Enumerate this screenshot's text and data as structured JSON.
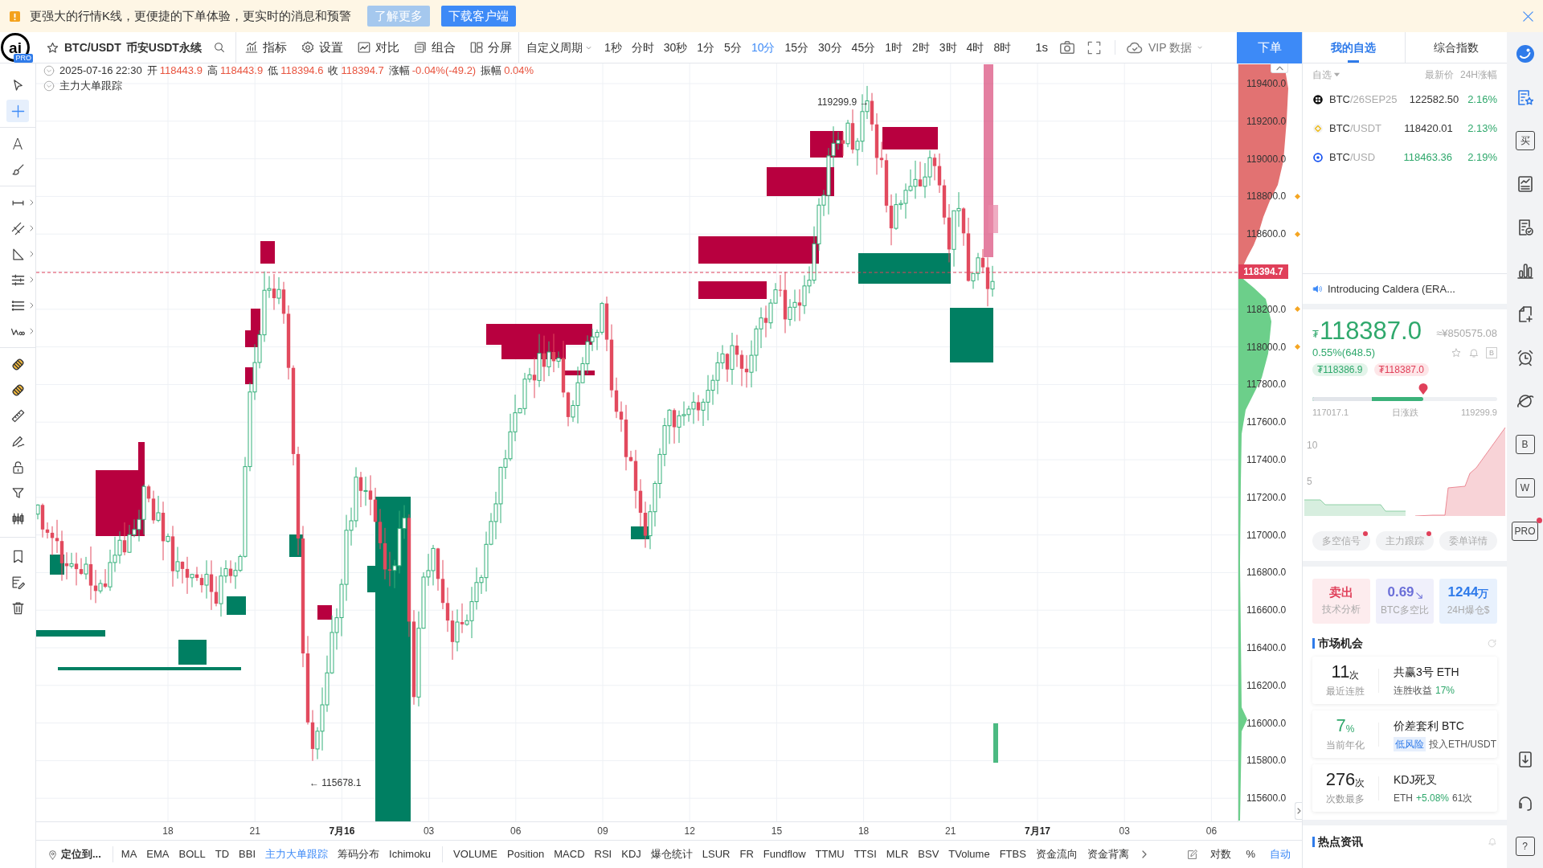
{
  "banner": {
    "message": "更强大的行情K线，更便捷的下单体验，更实时的消息和预警",
    "buttons": [
      {
        "label": "了解更多",
        "kind": "secondary"
      },
      {
        "label": "下载客户端",
        "kind": "primary"
      }
    ]
  },
  "toolbar": {
    "logo": {
      "mark": "ai",
      "badge": "PRO"
    },
    "symbol": "BTC/USDT",
    "market": "币安USDT永续",
    "tools": [
      "指标",
      "设置",
      "对比",
      "组合",
      "分屏"
    ],
    "custom_period": "自定义周期",
    "periods": [
      {
        "label": "1秒",
        "selected": false
      },
      {
        "label": "分时",
        "selected": false
      },
      {
        "label": "30秒",
        "selected": false
      },
      {
        "label": "1分",
        "selected": false
      },
      {
        "label": "5分",
        "selected": false
      },
      {
        "label": "10分",
        "selected": true
      },
      {
        "label": "15分",
        "selected": false
      },
      {
        "label": "30分",
        "selected": false
      },
      {
        "label": "45分",
        "selected": false
      },
      {
        "label": "1时",
        "selected": false
      },
      {
        "label": "2时",
        "selected": false
      },
      {
        "label": "3时",
        "selected": false
      },
      {
        "label": "4时",
        "selected": false
      },
      {
        "label": "8时",
        "selected": false
      }
    ],
    "interval": "1s",
    "vip": "VIP 数据",
    "order_button": "下单"
  },
  "tool_groups": [
    {
      "tools": [
        {
          "selected": false,
          "submenu": false
        },
        {
          "selected": true,
          "submenu": false
        }
      ]
    },
    {
      "tools": [
        {
          "glyph": "A",
          "selected": false,
          "submenu": false
        },
        {
          "selected": false,
          "submenu": false
        }
      ]
    },
    {
      "tools": [
        {
          "selected": false,
          "submenu": true
        },
        {
          "selected": false,
          "submenu": true
        },
        {
          "selected": false,
          "submenu": true
        },
        {
          "selected": false,
          "submenu": true
        },
        {
          "selected": false,
          "submenu": true
        },
        {
          "selected": false,
          "submenu": true
        }
      ]
    },
    {
      "tools": [
        {
          "selected": false,
          "submenu": false
        },
        {
          "selected": false,
          "submenu": false
        },
        {
          "selected": false,
          "submenu": false
        },
        {
          "selected": false,
          "submenu": false
        },
        {
          "selected": false,
          "submenu": false
        },
        {
          "selected": false,
          "submenu": false
        },
        {
          "selected": false,
          "submenu": false
        }
      ]
    },
    {
      "tools": [
        {
          "selected": false,
          "submenu": false
        },
        {
          "selected": false,
          "submenu": false
        },
        {
          "selected": false,
          "submenu": false
        }
      ]
    }
  ],
  "chart": {
    "legend": {
      "datetime": "2025-07-16 22:30",
      "fields": [
        {
          "label": "开",
          "value": "118443.9"
        },
        {
          "label": "高",
          "value": "118443.9"
        },
        {
          "label": "低",
          "value": "118394.6"
        },
        {
          "label": "收",
          "value": "118394.7"
        },
        {
          "label": "涨幅",
          "value": "-0.04%(-49.2)"
        },
        {
          "label": "振幅",
          "value": "0.04%"
        }
      ]
    },
    "indicator": "主力大单跟踪",
    "high_label": "119299.9 →",
    "low_label": "← 115678.1",
    "price_axis": [
      {
        "label": "119400.0",
        "kind": "tick",
        "marker": false
      },
      {
        "label": "119200.0",
        "kind": "tick",
        "marker": false
      },
      {
        "label": "119000.0",
        "kind": "tick",
        "marker": false
      },
      {
        "label": "118800.0",
        "kind": "tick",
        "marker": true
      },
      {
        "label": "118600.0",
        "kind": "tick",
        "marker": true
      },
      {
        "label": "118394.7",
        "kind": "current",
        "marker": false
      },
      {
        "label": "118200.0",
        "kind": "tick",
        "marker": true
      },
      {
        "label": "118000.0",
        "kind": "tick",
        "marker": true
      },
      {
        "label": "117800.0",
        "kind": "tick",
        "marker": false
      },
      {
        "label": "117600.0",
        "kind": "tick",
        "marker": false
      },
      {
        "label": "117400.0",
        "kind": "tick",
        "marker": false
      },
      {
        "label": "117200.0",
        "kind": "tick",
        "marker": false
      },
      {
        "label": "117000.0",
        "kind": "tick",
        "marker": false
      },
      {
        "label": "116800.0",
        "kind": "tick",
        "marker": false
      },
      {
        "label": "116600.0",
        "kind": "tick",
        "marker": false
      },
      {
        "label": "116400.0",
        "kind": "tick",
        "marker": false
      },
      {
        "label": "116200.0",
        "kind": "tick",
        "marker": false
      },
      {
        "label": "116000.0",
        "kind": "tick",
        "marker": false
      },
      {
        "label": "115800.0",
        "kind": "tick",
        "marker": false
      },
      {
        "label": "115600.0",
        "kind": "tick",
        "marker": false
      }
    ],
    "time_axis": [
      {
        "label": "18",
        "kind": "hour"
      },
      {
        "label": "21",
        "kind": "hour"
      },
      {
        "label": "7月16",
        "kind": "day"
      },
      {
        "label": "03",
        "kind": "hour"
      },
      {
        "label": "06",
        "kind": "hour"
      },
      {
        "label": "09",
        "kind": "hour"
      },
      {
        "label": "12",
        "kind": "hour"
      },
      {
        "label": "15",
        "kind": "hour"
      },
      {
        "label": "18",
        "kind": "hour"
      },
      {
        "label": "21",
        "kind": "hour"
      },
      {
        "label": "7月17",
        "kind": "day"
      },
      {
        "label": "03",
        "kind": "hour"
      },
      {
        "label": "06",
        "kind": "hour"
      }
    ]
  },
  "indicator_bar": {
    "locate": "定位到...",
    "main": [
      {
        "label": "MA",
        "selected": false
      },
      {
        "label": "EMA",
        "selected": false
      },
      {
        "label": "BOLL",
        "selected": false
      },
      {
        "label": "TD",
        "selected": false
      },
      {
        "label": "BBI",
        "selected": false
      },
      {
        "label": "主力大单跟踪",
        "selected": true
      },
      {
        "label": "筹码分布",
        "selected": false
      },
      {
        "label": "Ichimoku",
        "selected": false
      }
    ],
    "sub": [
      {
        "label": "VOLUME",
        "selected": false
      },
      {
        "label": "Position",
        "selected": false
      },
      {
        "label": "MACD",
        "selected": false
      },
      {
        "label": "RSI",
        "selected": false
      },
      {
        "label": "KDJ",
        "selected": false
      },
      {
        "label": "爆仓统计",
        "selected": false
      },
      {
        "label": "LSUR",
        "selected": false
      },
      {
        "label": "FR",
        "selected": false
      },
      {
        "label": "Fundflow",
        "selected": false
      },
      {
        "label": "TTMU",
        "selected": false
      },
      {
        "label": "TTSI",
        "selected": false
      },
      {
        "label": "MLR",
        "selected": false
      },
      {
        "label": "BSV",
        "selected": false
      },
      {
        "label": "TVolume",
        "selected": false
      },
      {
        "label": "FTBS",
        "selected": false
      },
      {
        "label": "资金流向",
        "selected": false
      },
      {
        "label": "资金背离",
        "selected": false
      }
    ],
    "scales": [
      {
        "label": "对数",
        "selected": false
      },
      {
        "label": "%",
        "selected": false
      },
      {
        "label": "自动",
        "selected": true
      }
    ]
  },
  "right_panel": {
    "tabs": [
      {
        "label": "我的自选",
        "selected": true
      },
      {
        "label": "综合指数",
        "selected": false
      }
    ],
    "watchlist": {
      "filter": "自选",
      "columns": [
        "最新价",
        "24H涨幅"
      ],
      "rows": [
        {
          "base": "BTC",
          "quote": "/26SEP25",
          "price": "122582.50",
          "change": "2.16%",
          "price_up": false
        },
        {
          "base": "BTC",
          "quote": "/USDT",
          "price": "118420.01",
          "change": "2.13%",
          "price_up": false
        },
        {
          "base": "BTC",
          "quote": "/USD",
          "price": "118463.36",
          "change": "2.19%",
          "price_up": true
        }
      ]
    },
    "news_ticker": "Introducing Caldera (ERA...",
    "quote": {
      "currency": "₮",
      "price": "118387.0",
      "converted": "≈¥850575.08",
      "change": "0.55%(648.5)",
      "action_glyph": "B",
      "bid": "₮118386.9",
      "ask": "₮118387.0",
      "range": {
        "low": "117017.1",
        "label": "日涨跌",
        "high": "119299.9",
        "level": 0.6,
        "open": {
          "level": 0.32
        }
      }
    },
    "depth_chart": {
      "axis_labels": [
        "10",
        "5"
      ]
    },
    "signal_tabs": [
      {
        "label": "多空信号",
        "dot": true
      },
      {
        "label": "主力跟踪",
        "dot": true
      },
      {
        "label": "委单详情",
        "dot": false
      }
    ],
    "stat_cards": [
      {
        "value": "卖出",
        "label": "技术分析",
        "kind": "sell",
        "falling": false
      },
      {
        "value": "0.69",
        "label": "BTC多空比",
        "kind": "ratio",
        "falling": true
      },
      {
        "value": "1244",
        "unit": "万",
        "label": "24H爆仓$",
        "kind": "volume",
        "falling": false
      }
    ],
    "opportunities": {
      "title": "市场机会",
      "items": [
        {
          "value": "11",
          "unit": "次",
          "gain": false,
          "caption": "最近连胜",
          "title": "共赢3号 ETH",
          "detail": [
            {
              "text": "连胜收益",
              "kind": "plain"
            },
            {
              "text": "17%",
              "kind": "gain"
            }
          ]
        },
        {
          "value": "7",
          "unit": "%",
          "gain": true,
          "caption": "当前年化",
          "title": "价差套利 BTC",
          "detail": [
            {
              "text": "低风险",
              "kind": "tag"
            },
            {
              "text": "投入ETH/USDT",
              "kind": "plain"
            }
          ]
        },
        {
          "value": "276",
          "unit": "次",
          "gain": false,
          "caption": "次数最多",
          "title": "KDJ死叉",
          "detail": [
            {
              "text": "ETH",
              "kind": "plain"
            },
            {
              "text": "+5.08%",
              "kind": "gain"
            },
            {
              "text": "61次",
              "kind": "plain"
            }
          ]
        }
      ]
    },
    "hot_news": {
      "title": "热点资讯"
    }
  },
  "side_rail": {
    "top": [
      {
        "kind": "icon",
        "dot": false
      },
      {
        "kind": "icon",
        "dot": false
      },
      {
        "kind": "glyph",
        "label": "买",
        "dot": false
      },
      {
        "kind": "icon",
        "dot": false
      },
      {
        "kind": "icon",
        "dot": false
      },
      {
        "kind": "icon",
        "dot": false
      },
      {
        "kind": "icon",
        "dot": false
      },
      {
        "kind": "icon",
        "dot": false
      },
      {
        "kind": "icon",
        "dot": false
      },
      {
        "kind": "glyph",
        "label": "B",
        "dot": false
      },
      {
        "kind": "glyph",
        "label": "W",
        "dot": false
      },
      {
        "kind": "glyph",
        "label": "PRO",
        "dot": true
      }
    ],
    "bottom": [
      {
        "kind": "icon",
        "dot": false
      },
      {
        "kind": "icon",
        "dot": false
      },
      {
        "kind": "glyph",
        "label": "?",
        "dot": false
      }
    ]
  }
}
